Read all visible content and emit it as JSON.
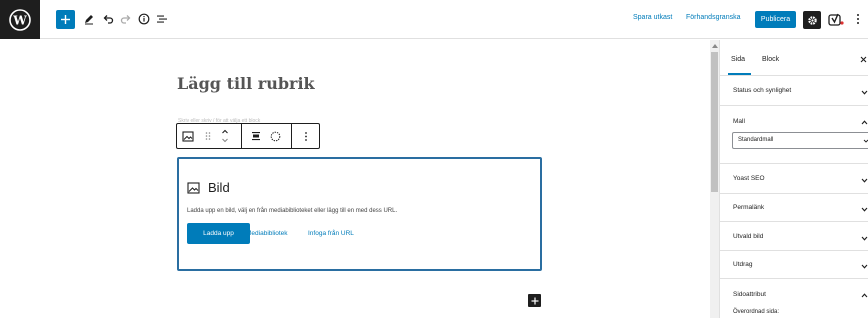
{
  "topbar": {
    "save_draft": "Spara utkast",
    "preview": "Förhandsgranska",
    "publish": "Publicera"
  },
  "editor": {
    "title_placeholder": "Lägg till rubrik",
    "hidden_paragraph": "Skriv eller skriv / för att välja ett block",
    "image_block": {
      "title": "Bild",
      "instructions": "Ladda upp en bild, välj en från mediabiblioteket eller lägg till en med dess URL.",
      "upload_label": "Ladda upp",
      "media_library_label": "Mediabibliotek",
      "insert_url_label": "Infoga från URL"
    }
  },
  "sidebar": {
    "tabs": [
      {
        "label": "Sida",
        "active": true
      },
      {
        "label": "Block",
        "active": false
      }
    ],
    "panels": {
      "status": "Status och synlighet",
      "template": "Mall",
      "template_value": "Standardmall",
      "yoast": "Yoast SEO",
      "permalink": "Permalänk",
      "featured_image": "Utvald bild",
      "excerpt": "Utdrag",
      "page_attributes": "Sidoattribut",
      "parent_page": "Överordnad sida:"
    }
  },
  "icons": {
    "logo": "wordpress-logo",
    "add": "plus-icon",
    "tools": "pencil-icon",
    "undo": "undo-icon",
    "redo": "redo-icon",
    "details": "info-icon",
    "outline": "list-view-icon",
    "settings": "gear-icon",
    "yoast": "yoast-icon",
    "more": "more-vertical-icon"
  },
  "colors": {
    "accent": "#007cba",
    "dark": "#1e1e1e",
    "block_border": "#2a6ea1"
  }
}
